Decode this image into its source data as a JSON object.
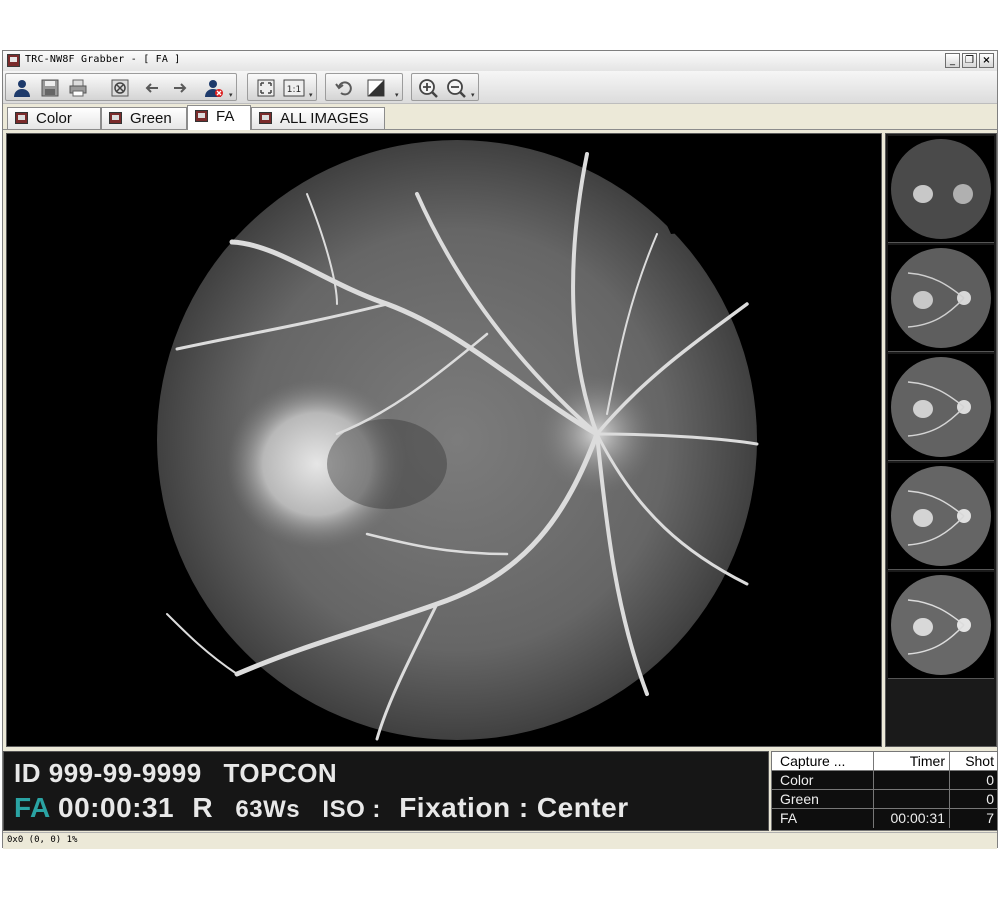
{
  "window": {
    "title": "TRC-NW8F Grabber - [ FA ]",
    "minimize": "_",
    "restore": "❐",
    "close": "×"
  },
  "tabs": [
    {
      "label": "Color"
    },
    {
      "label": "Green"
    },
    {
      "label": "FA",
      "active": true
    },
    {
      "label": "ALL IMAGES"
    }
  ],
  "info": {
    "id_label": "ID",
    "patient_id": "999-99-9999",
    "company": "TOPCON",
    "mode": "FA",
    "mode_color": "#2aa3a3",
    "time": "00:00:31",
    "eye": "R",
    "flash": "63Ws",
    "iso": "ISO :",
    "fixation": "Fixation : Center"
  },
  "capture_table": {
    "headers": [
      "Capture ...",
      "Timer",
      "Shot"
    ],
    "rows": [
      {
        "name": "Color",
        "timer": "",
        "shot": "0"
      },
      {
        "name": "Green",
        "timer": "",
        "shot": "0"
      },
      {
        "name": "FA",
        "timer": "00:00:31",
        "shot": "7"
      }
    ]
  },
  "status": {
    "text": "0x0  (0, 0)  1%"
  },
  "thumbnails_count": 5,
  "icons": [
    "patient-icon",
    "save-icon",
    "print-icon",
    "delete-icon",
    "back-arrow-icon",
    "forward-arrow-icon",
    "delete-patient-icon",
    "fit-screen-icon",
    "actual-size-icon",
    "undo-icon",
    "contrast-icon",
    "zoom-in-icon",
    "zoom-out-icon"
  ]
}
